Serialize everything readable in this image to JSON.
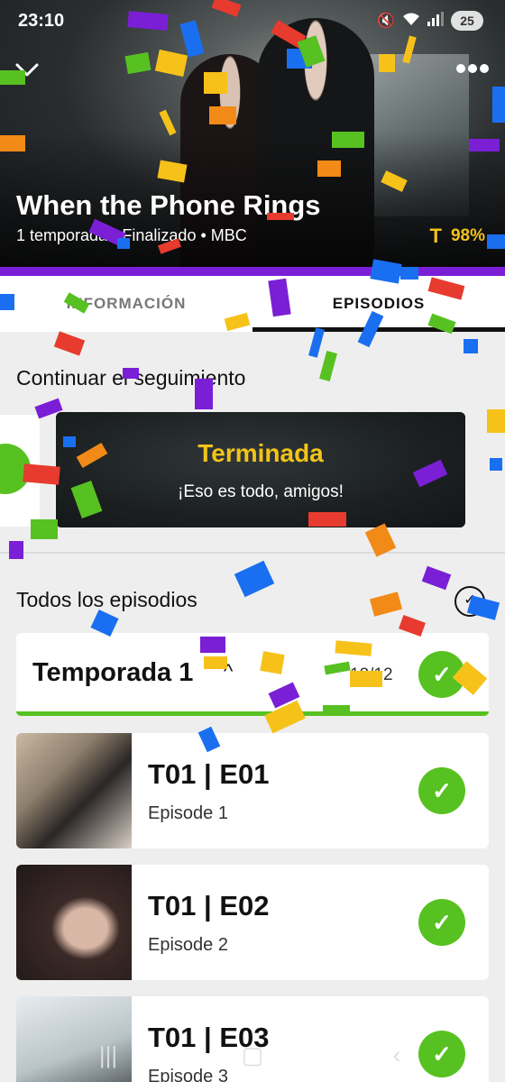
{
  "status_bar": {
    "time": "23:10",
    "battery": "25"
  },
  "show": {
    "title": "When the Phone Rings",
    "seasons": "1 temporada",
    "state": "Finalizado",
    "network": "MBC",
    "score": "98%"
  },
  "tabs": [
    {
      "label": "INFORMACIÓN",
      "active": false
    },
    {
      "label": "EPISODIOS",
      "active": true
    }
  ],
  "continue": {
    "heading": "Continuar el seguimiento",
    "card_title": "Terminada",
    "card_subtitle": "¡Eso es todo, amigos!"
  },
  "all_episodes": {
    "heading": "Todos los episodios",
    "season": {
      "label": "Temporada 1",
      "count": "12/12",
      "watched": true
    },
    "episodes": [
      {
        "code": "T01 | E01",
        "name": "Episode 1",
        "watched": true
      },
      {
        "code": "T01 | E02",
        "name": "Episode 2",
        "watched": true
      },
      {
        "code": "T01 | E03",
        "name": "Episode 3",
        "watched": true
      }
    ]
  },
  "colors": {
    "accent_purple": "#7a1fd6",
    "watched_green": "#57c121",
    "score_yellow": "#f3c21e"
  }
}
